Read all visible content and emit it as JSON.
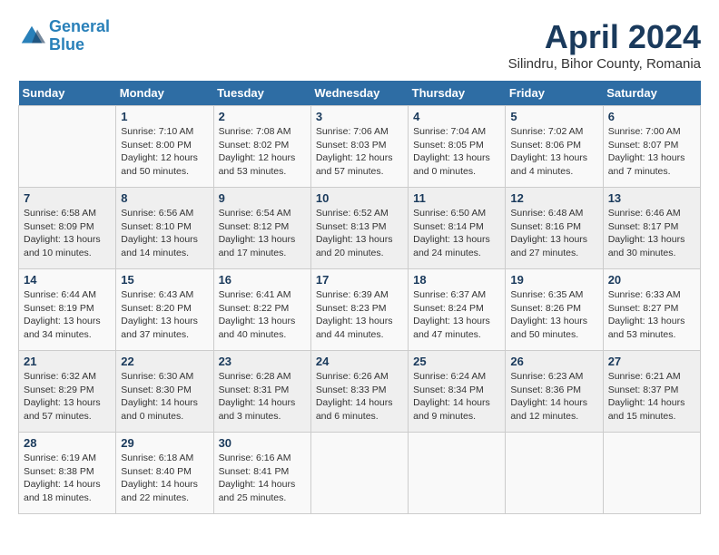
{
  "header": {
    "logo_line1": "General",
    "logo_line2": "Blue",
    "month": "April 2024",
    "location": "Silindru, Bihor County, Romania"
  },
  "weekdays": [
    "Sunday",
    "Monday",
    "Tuesday",
    "Wednesday",
    "Thursday",
    "Friday",
    "Saturday"
  ],
  "weeks": [
    [
      {
        "day": "",
        "sunrise": "",
        "sunset": "",
        "daylight": ""
      },
      {
        "day": "1",
        "sunrise": "Sunrise: 7:10 AM",
        "sunset": "Sunset: 8:00 PM",
        "daylight": "Daylight: 12 hours and 50 minutes."
      },
      {
        "day": "2",
        "sunrise": "Sunrise: 7:08 AM",
        "sunset": "Sunset: 8:02 PM",
        "daylight": "Daylight: 12 hours and 53 minutes."
      },
      {
        "day": "3",
        "sunrise": "Sunrise: 7:06 AM",
        "sunset": "Sunset: 8:03 PM",
        "daylight": "Daylight: 12 hours and 57 minutes."
      },
      {
        "day": "4",
        "sunrise": "Sunrise: 7:04 AM",
        "sunset": "Sunset: 8:05 PM",
        "daylight": "Daylight: 13 hours and 0 minutes."
      },
      {
        "day": "5",
        "sunrise": "Sunrise: 7:02 AM",
        "sunset": "Sunset: 8:06 PM",
        "daylight": "Daylight: 13 hours and 4 minutes."
      },
      {
        "day": "6",
        "sunrise": "Sunrise: 7:00 AM",
        "sunset": "Sunset: 8:07 PM",
        "daylight": "Daylight: 13 hours and 7 minutes."
      }
    ],
    [
      {
        "day": "7",
        "sunrise": "Sunrise: 6:58 AM",
        "sunset": "Sunset: 8:09 PM",
        "daylight": "Daylight: 13 hours and 10 minutes."
      },
      {
        "day": "8",
        "sunrise": "Sunrise: 6:56 AM",
        "sunset": "Sunset: 8:10 PM",
        "daylight": "Daylight: 13 hours and 14 minutes."
      },
      {
        "day": "9",
        "sunrise": "Sunrise: 6:54 AM",
        "sunset": "Sunset: 8:12 PM",
        "daylight": "Daylight: 13 hours and 17 minutes."
      },
      {
        "day": "10",
        "sunrise": "Sunrise: 6:52 AM",
        "sunset": "Sunset: 8:13 PM",
        "daylight": "Daylight: 13 hours and 20 minutes."
      },
      {
        "day": "11",
        "sunrise": "Sunrise: 6:50 AM",
        "sunset": "Sunset: 8:14 PM",
        "daylight": "Daylight: 13 hours and 24 minutes."
      },
      {
        "day": "12",
        "sunrise": "Sunrise: 6:48 AM",
        "sunset": "Sunset: 8:16 PM",
        "daylight": "Daylight: 13 hours and 27 minutes."
      },
      {
        "day": "13",
        "sunrise": "Sunrise: 6:46 AM",
        "sunset": "Sunset: 8:17 PM",
        "daylight": "Daylight: 13 hours and 30 minutes."
      }
    ],
    [
      {
        "day": "14",
        "sunrise": "Sunrise: 6:44 AM",
        "sunset": "Sunset: 8:19 PM",
        "daylight": "Daylight: 13 hours and 34 minutes."
      },
      {
        "day": "15",
        "sunrise": "Sunrise: 6:43 AM",
        "sunset": "Sunset: 8:20 PM",
        "daylight": "Daylight: 13 hours and 37 minutes."
      },
      {
        "day": "16",
        "sunrise": "Sunrise: 6:41 AM",
        "sunset": "Sunset: 8:22 PM",
        "daylight": "Daylight: 13 hours and 40 minutes."
      },
      {
        "day": "17",
        "sunrise": "Sunrise: 6:39 AM",
        "sunset": "Sunset: 8:23 PM",
        "daylight": "Daylight: 13 hours and 44 minutes."
      },
      {
        "day": "18",
        "sunrise": "Sunrise: 6:37 AM",
        "sunset": "Sunset: 8:24 PM",
        "daylight": "Daylight: 13 hours and 47 minutes."
      },
      {
        "day": "19",
        "sunrise": "Sunrise: 6:35 AM",
        "sunset": "Sunset: 8:26 PM",
        "daylight": "Daylight: 13 hours and 50 minutes."
      },
      {
        "day": "20",
        "sunrise": "Sunrise: 6:33 AM",
        "sunset": "Sunset: 8:27 PM",
        "daylight": "Daylight: 13 hours and 53 minutes."
      }
    ],
    [
      {
        "day": "21",
        "sunrise": "Sunrise: 6:32 AM",
        "sunset": "Sunset: 8:29 PM",
        "daylight": "Daylight: 13 hours and 57 minutes."
      },
      {
        "day": "22",
        "sunrise": "Sunrise: 6:30 AM",
        "sunset": "Sunset: 8:30 PM",
        "daylight": "Daylight: 14 hours and 0 minutes."
      },
      {
        "day": "23",
        "sunrise": "Sunrise: 6:28 AM",
        "sunset": "Sunset: 8:31 PM",
        "daylight": "Daylight: 14 hours and 3 minutes."
      },
      {
        "day": "24",
        "sunrise": "Sunrise: 6:26 AM",
        "sunset": "Sunset: 8:33 PM",
        "daylight": "Daylight: 14 hours and 6 minutes."
      },
      {
        "day": "25",
        "sunrise": "Sunrise: 6:24 AM",
        "sunset": "Sunset: 8:34 PM",
        "daylight": "Daylight: 14 hours and 9 minutes."
      },
      {
        "day": "26",
        "sunrise": "Sunrise: 6:23 AM",
        "sunset": "Sunset: 8:36 PM",
        "daylight": "Daylight: 14 hours and 12 minutes."
      },
      {
        "day": "27",
        "sunrise": "Sunrise: 6:21 AM",
        "sunset": "Sunset: 8:37 PM",
        "daylight": "Daylight: 14 hours and 15 minutes."
      }
    ],
    [
      {
        "day": "28",
        "sunrise": "Sunrise: 6:19 AM",
        "sunset": "Sunset: 8:38 PM",
        "daylight": "Daylight: 14 hours and 18 minutes."
      },
      {
        "day": "29",
        "sunrise": "Sunrise: 6:18 AM",
        "sunset": "Sunset: 8:40 PM",
        "daylight": "Daylight: 14 hours and 22 minutes."
      },
      {
        "day": "30",
        "sunrise": "Sunrise: 6:16 AM",
        "sunset": "Sunset: 8:41 PM",
        "daylight": "Daylight: 14 hours and 25 minutes."
      },
      {
        "day": "",
        "sunrise": "",
        "sunset": "",
        "daylight": ""
      },
      {
        "day": "",
        "sunrise": "",
        "sunset": "",
        "daylight": ""
      },
      {
        "day": "",
        "sunrise": "",
        "sunset": "",
        "daylight": ""
      },
      {
        "day": "",
        "sunrise": "",
        "sunset": "",
        "daylight": ""
      }
    ]
  ]
}
